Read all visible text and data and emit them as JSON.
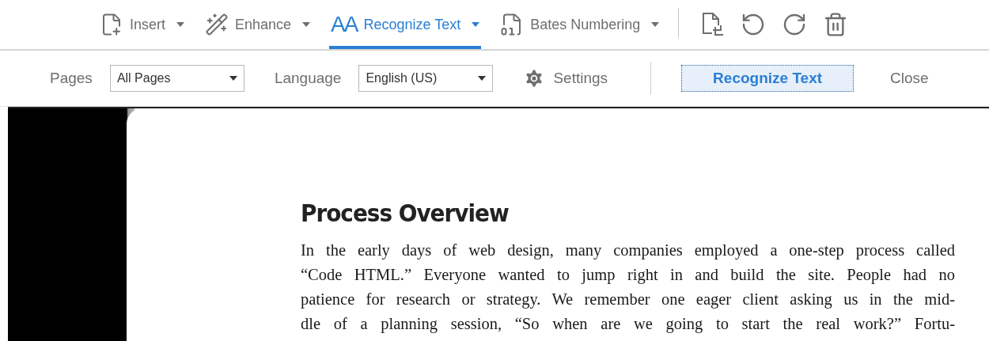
{
  "toolbar": {
    "tabs": [
      {
        "kind": "insert",
        "label": "Insert",
        "selected": false
      },
      {
        "kind": "enhance",
        "label": "Enhance",
        "selected": false
      },
      {
        "kind": "ocr",
        "glyph": "AA",
        "label": "Recognize Text",
        "selected": true
      },
      {
        "kind": "bates",
        "label": "Bates Numbering",
        "selected": false
      }
    ],
    "tools": [
      {
        "kind": "crop"
      },
      {
        "kind": "undo"
      },
      {
        "kind": "redo"
      },
      {
        "kind": "delete"
      }
    ]
  },
  "options_bar": {
    "pages_label": "Pages",
    "pages_value": "All Pages",
    "language_label": "Language",
    "language_value": "English (US)",
    "settings": "Settings",
    "primary_button": "Recognize Text",
    "close_button": "Close"
  },
  "document": {
    "heading": "Process Overview",
    "lines": [
      "In the early days of web design, many companies employed a one-step process called",
      "“Code HTML.” Everyone wanted to jump right in and build the site. People had no",
      "patience for research or strategy. We remember one eager client asking us in the mid-",
      "dle of a planning session, “So when are we going to start the real work?” Fortu-"
    ]
  }
}
